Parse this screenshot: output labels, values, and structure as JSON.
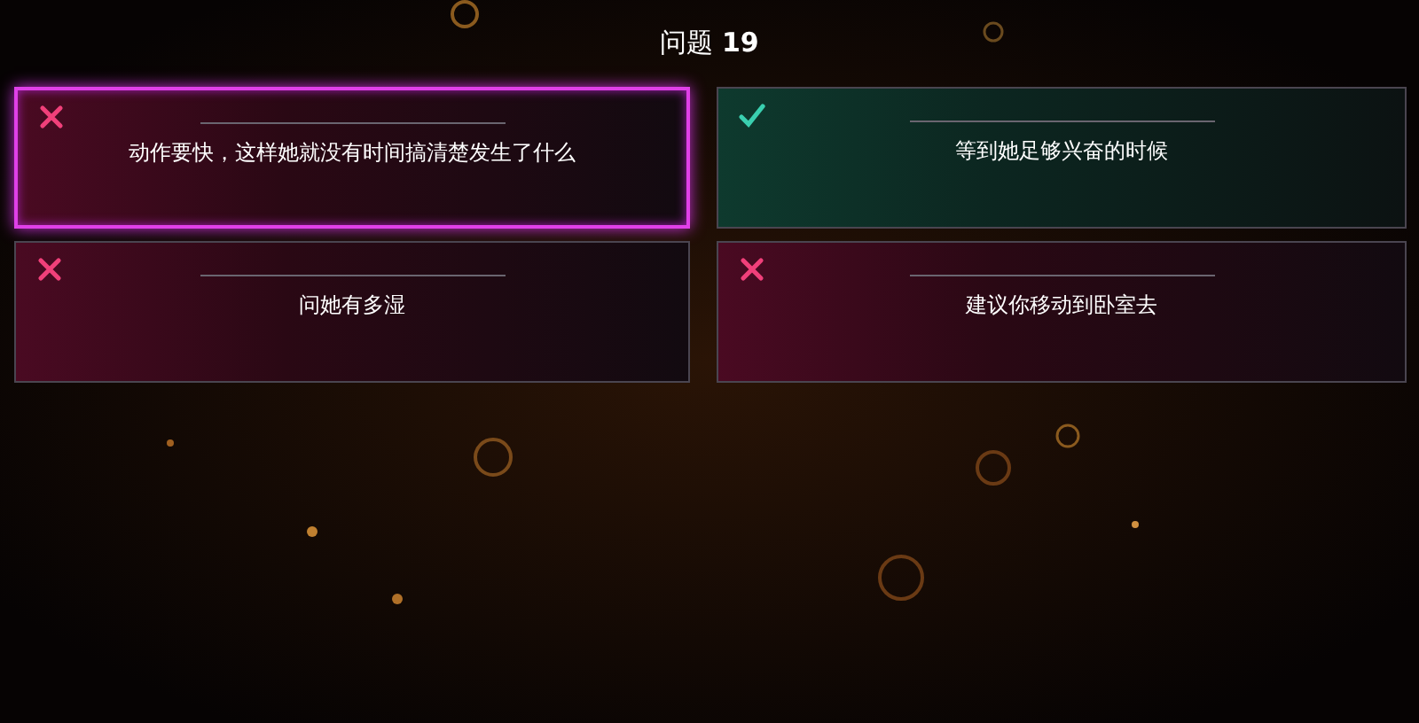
{
  "title": "问题 **19**",
  "answers": [
    {
      "text": "动作要快，这样她就没有时间搞清楚发生了什么",
      "correct": false,
      "selected": true
    },
    {
      "text": "等到她足够兴奋的时候",
      "correct": true,
      "selected": false
    },
    {
      "text": "问她有多湿",
      "correct": false,
      "selected": false
    },
    {
      "text": "建议你移动到卧室去",
      "correct": false,
      "selected": false
    }
  ]
}
